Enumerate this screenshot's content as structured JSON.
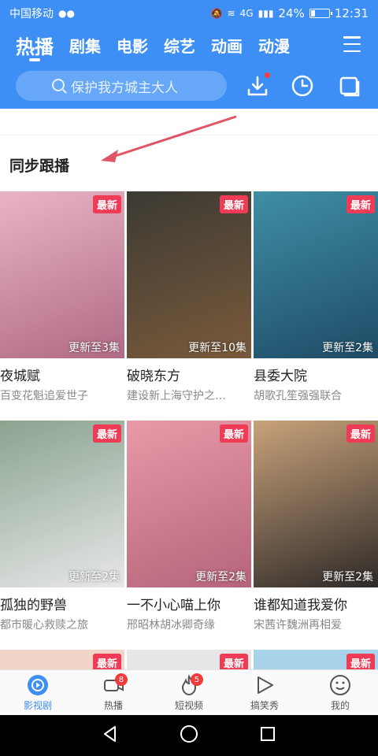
{
  "status_bar": {
    "carrier": "中国移动",
    "network": "4G",
    "battery_text": "24%",
    "battery_level": 0.24,
    "time": "12:31"
  },
  "tabs": [
    {
      "label": "热播",
      "active": true
    },
    {
      "label": "剧集"
    },
    {
      "label": "电影"
    },
    {
      "label": "综艺"
    },
    {
      "label": "动画"
    },
    {
      "label": "动漫"
    }
  ],
  "search": {
    "placeholder": "保护我方城主大人"
  },
  "section": {
    "title": "同步跟播"
  },
  "badge_new": "最新",
  "cards": [
    {
      "title": "夜城赋",
      "subtitle": "百变花魁追爱世子",
      "update": "更新至3集",
      "poster_bg": "#e9b4c4",
      "poster_fg": "#b06a85"
    },
    {
      "title": "破晓东方",
      "subtitle": "建设新上海守护之…",
      "update": "更新至10集",
      "poster_bg": "#3b3a33",
      "poster_fg": "#7a5a3b"
    },
    {
      "title": "县委大院",
      "subtitle": "胡歌孔笙强强联合",
      "update": "更新至2集",
      "poster_bg": "#3e8fa5",
      "poster_fg": "#1f4b66"
    },
    {
      "title": "孤独的野兽",
      "subtitle": "都市暖心救赎之旅",
      "update": "更新至2集",
      "poster_bg": "#8aa38f",
      "poster_fg": "#e8e8e8"
    },
    {
      "title": "一不小心喵上你",
      "subtitle": "邢昭林胡冰卿奇缘",
      "update": "更新至2集",
      "poster_bg": "#e99aa8",
      "poster_fg": "#b5647a"
    },
    {
      "title": "谁都知道我爱你",
      "subtitle": "宋茜许魏洲再相爱",
      "update": "更新至2集",
      "poster_bg": "#c9a27a",
      "poster_fg": "#2e2a28"
    }
  ],
  "bottom_nav": [
    {
      "label": "影视剧",
      "icon": "play-circle-icon",
      "active": true
    },
    {
      "label": "热播",
      "icon": "video-camera-icon",
      "badge": "8"
    },
    {
      "label": "短视频",
      "icon": "flame-icon",
      "badge": "5"
    },
    {
      "label": "搞笑秀",
      "icon": "play-triangle-icon"
    },
    {
      "label": "我的",
      "icon": "smiley-face-icon"
    }
  ],
  "colors": {
    "brand_blue": "#3d8ff5",
    "badge_red": "#ef3b55",
    "arrow_red": "#e05565"
  }
}
